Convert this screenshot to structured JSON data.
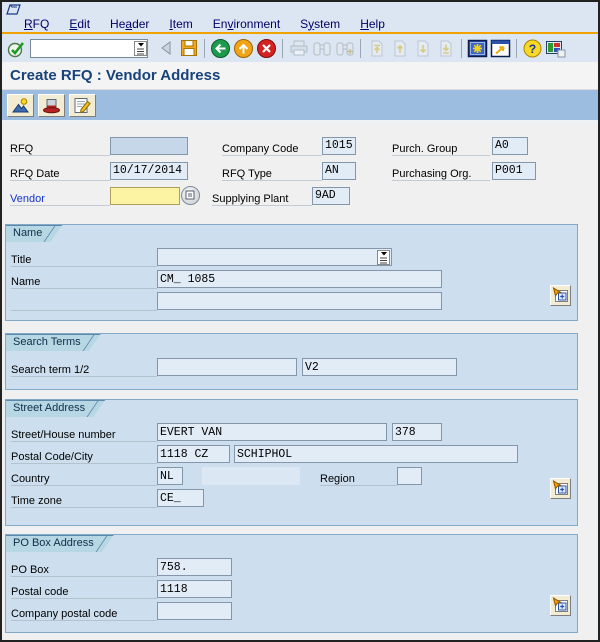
{
  "page": {
    "title": "Create RFQ : Vendor Address"
  },
  "menu": {
    "items": [
      {
        "pre": "",
        "mn": "R",
        "post": "FQ"
      },
      {
        "pre": "",
        "mn": "E",
        "post": "dit"
      },
      {
        "pre": "He",
        "mn": "a",
        "post": "der"
      },
      {
        "pre": "",
        "mn": "I",
        "post": "tem"
      },
      {
        "pre": "En",
        "mn": "v",
        "post": "ironment"
      },
      {
        "pre": "S",
        "mn": "y",
        "post": "stem"
      },
      {
        "pre": "",
        "mn": "H",
        "post": "elp"
      }
    ]
  },
  "toolbar": {
    "command_value": "",
    "icons": [
      "enter-icon",
      "command-field",
      "back-step-icon",
      "save-icon",
      "back-icon",
      "exit-icon",
      "cancel-icon",
      "print-icon",
      "find-icon",
      "find-next-icon",
      "first-page-icon",
      "previous-page-icon",
      "next-page-icon",
      "last-page-icon",
      "new-session-icon",
      "create-shortcut-icon",
      "help-icon",
      "customize-layout-icon"
    ]
  },
  "app_toolbar": {
    "icons": [
      "person-icon",
      "header-hat-icon",
      "texts-icon"
    ]
  },
  "header_fields": {
    "rfq": {
      "label": "RFQ",
      "value": ""
    },
    "company_code": {
      "label": "Company Code",
      "value": "1015"
    },
    "purch_group": {
      "label": "Purch. Group",
      "value": "A0"
    },
    "rfq_date": {
      "label": "RFQ Date",
      "value": "10/17/2014"
    },
    "rfq_type": {
      "label": "RFQ Type",
      "value": "AN"
    },
    "purchasing_org": {
      "label": "Purchasing Org.",
      "value": "P001"
    },
    "vendor": {
      "label": "Vendor",
      "value": ""
    },
    "supplying_plant": {
      "label": "Supplying Plant",
      "value": "9AD"
    }
  },
  "sections": {
    "name": {
      "title": "Name",
      "title_row": {
        "label": "Title",
        "value": ""
      },
      "name_row": {
        "label": "Name",
        "value": "CM_ 1085"
      },
      "name2_row": {
        "value": ""
      }
    },
    "search_terms": {
      "title": "Search Terms",
      "row": {
        "label": "Search term 1/2",
        "term1": "",
        "term2": "V2"
      }
    },
    "street_address": {
      "title": "Street Address",
      "street_row": {
        "label": "Street/House number",
        "street": "EVERT VAN",
        "number": "378"
      },
      "postal_row": {
        "label": "Postal Code/City",
        "code": "1118 CZ",
        "city": "SCHIPHOL"
      },
      "country_row": {
        "label": "Country",
        "country": "NL",
        "country_name": "",
        "region_label": "Region",
        "region": ""
      },
      "timezone_row": {
        "label": "Time zone",
        "value": "CE_"
      }
    },
    "po_box_address": {
      "title": "PO Box Address",
      "po_box_row": {
        "label": "PO Box",
        "value": "758."
      },
      "postal_code_row": {
        "label": "Postal code",
        "value": "1118"
      },
      "company_postal_row": {
        "label": "Company postal code",
        "value": ""
      }
    }
  }
}
